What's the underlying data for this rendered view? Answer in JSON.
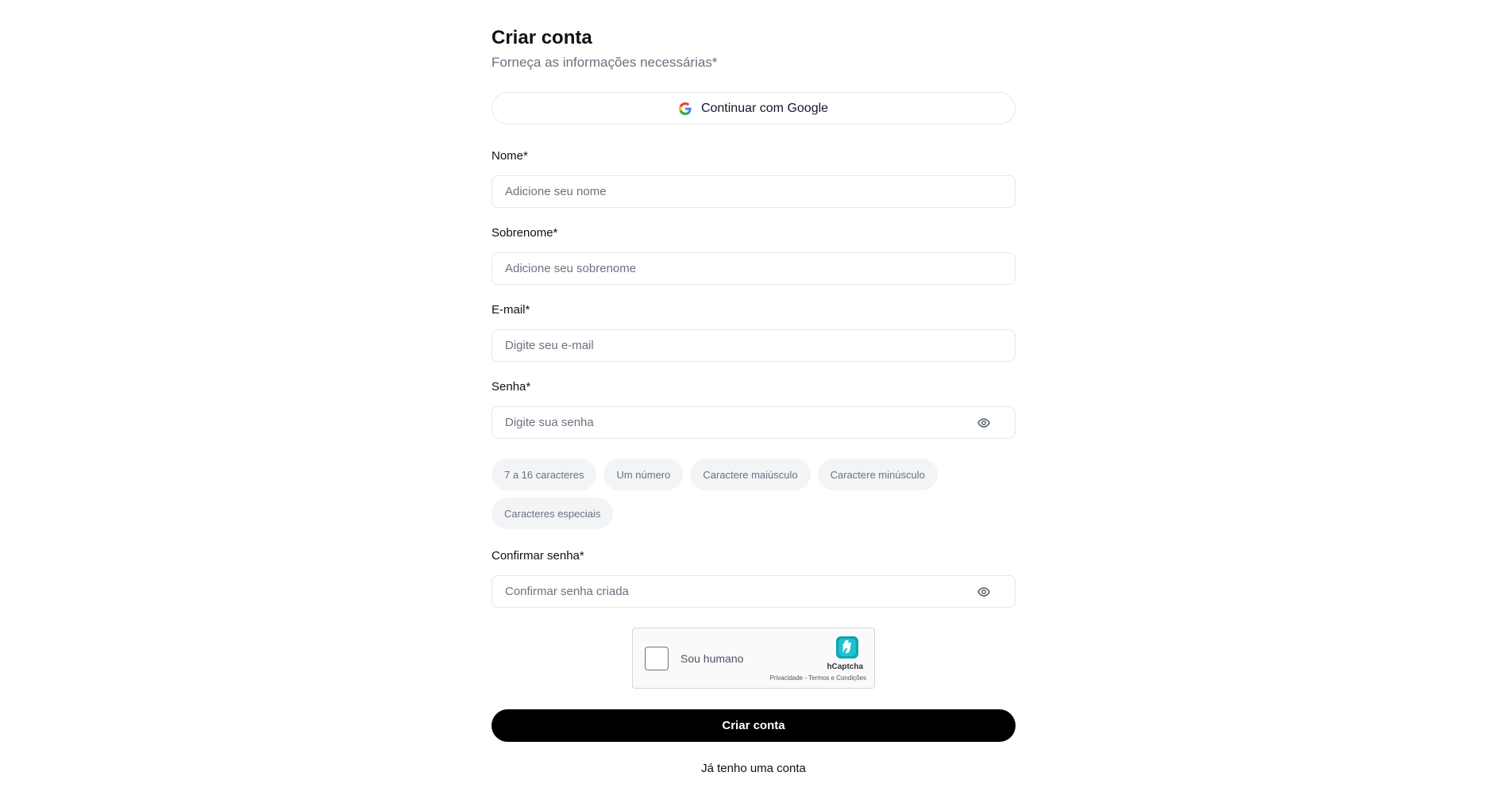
{
  "header": {
    "title": "Criar conta",
    "subtitle": "Forneça as informações necessárias*"
  },
  "google": {
    "label": "Continuar com Google",
    "icon": "google-icon"
  },
  "fields": {
    "first_name": {
      "label": "Nome*",
      "placeholder": "Adicione seu nome",
      "value": ""
    },
    "last_name": {
      "label": "Sobrenome*",
      "placeholder": "Adicione seu sobrenome",
      "value": ""
    },
    "email": {
      "label": "E-mail*",
      "placeholder": "Digite seu e-mail",
      "value": ""
    },
    "password": {
      "label": "Senha*",
      "placeholder": "Digite sua senha",
      "value": "",
      "icon": "eye-icon"
    },
    "confirm_password": {
      "label": "Confirmar senha*",
      "placeholder": "Confirmar senha criada",
      "value": "",
      "icon": "eye-icon"
    }
  },
  "password_rules": [
    "7 a 16 caracteres",
    "Um número",
    "Caractere maiúsculo",
    "Caractere minúsculo",
    "Caracteres especiais"
  ],
  "captcha": {
    "label": "Sou humano",
    "brand": "hCaptcha",
    "links": "Privacidade - Termos e Condições"
  },
  "actions": {
    "submit_label": "Criar conta",
    "login_label": "Já tenho uma conta"
  },
  "colors": {
    "primary_button": "#000000",
    "chip_background": "#f3f4f6",
    "border": "#e5e7eb",
    "muted_text": "#6b7280"
  }
}
